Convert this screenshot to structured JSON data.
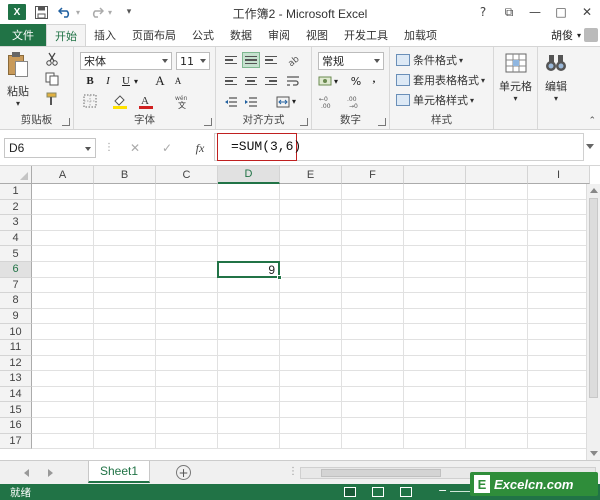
{
  "window": {
    "title": "工作簿2 - Microsoft Excel",
    "app_logo": "X",
    "help": "?",
    "ribbon_options": "⧉",
    "minimize": "—",
    "maximize": "□",
    "close": "✕"
  },
  "quick_access": {
    "save_icon": "save-icon",
    "undo_icon": "undo-icon",
    "redo_icon": "redo-icon"
  },
  "tabs": [
    "文件",
    "开始",
    "插入",
    "页面布局",
    "公式",
    "数据",
    "审阅",
    "视图",
    "开发工具",
    "加载项"
  ],
  "active_tab": "开始",
  "user_name": "胡俊",
  "ribbon": {
    "clipboard": {
      "label": "剪贴板",
      "paste": "粘贴"
    },
    "font": {
      "label": "字体",
      "name": "宋体",
      "size": "11",
      "bold": "B",
      "italic": "I",
      "underline": "U",
      "grow": "A",
      "shrink": "A"
    },
    "alignment": {
      "label": "对齐方式"
    },
    "number": {
      "label": "数字",
      "format": "常规",
      "percent": "%",
      "comma": ","
    },
    "styles": {
      "label": "样式",
      "conditional": "条件格式",
      "table": "套用表格格式",
      "cell": "单元格样式"
    },
    "cells": {
      "label": "单元格"
    },
    "editing": {
      "label": "编辑"
    }
  },
  "formula_bar": {
    "name_box": "D6",
    "cancel": "✕",
    "enter": "✓",
    "fx": "fx",
    "formula": "=SUM(3,6)"
  },
  "sheet": {
    "columns": [
      "A",
      "B",
      "C",
      "D",
      "E",
      "F",
      "",
      "",
      "I"
    ],
    "rows": [
      "1",
      "2",
      "3",
      "4",
      "5",
      "6",
      "7",
      "8",
      "9",
      "10",
      "11",
      "12",
      "13",
      "14",
      "15",
      "16",
      "17"
    ],
    "active_cell": "D6",
    "active_value": "9",
    "tabs": [
      "Sheet1"
    ]
  },
  "status": {
    "text": "就绪"
  },
  "watermark": {
    "letter": "E",
    "text": "Excelcn.com"
  },
  "colors": {
    "accent": "#217346",
    "highlight": "#c02020"
  }
}
